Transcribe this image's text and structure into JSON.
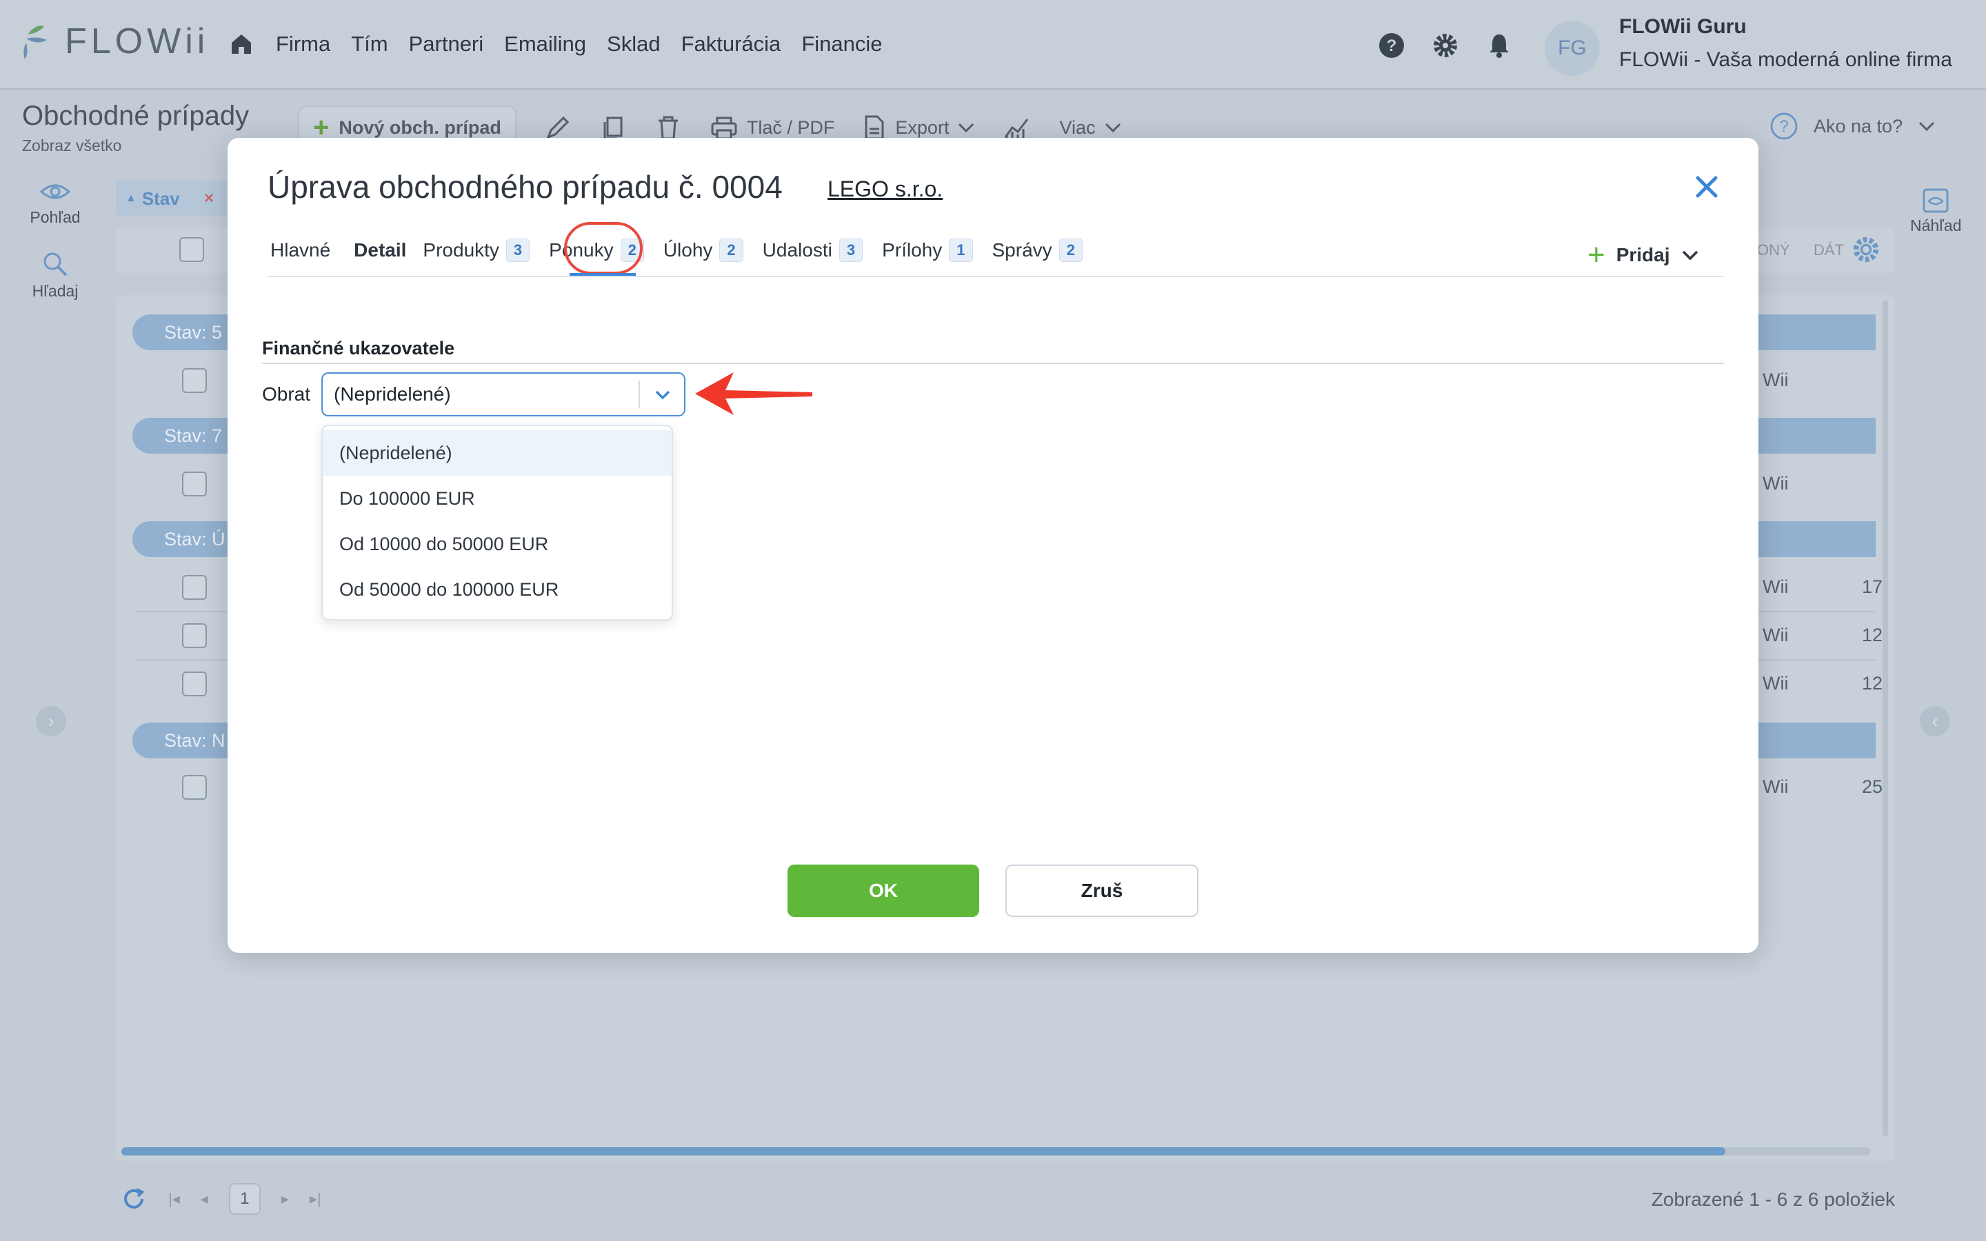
{
  "app": {
    "logo_text": "FLOWii",
    "nav": [
      "Firma",
      "Tím",
      "Partneri",
      "Emailing",
      "Sklad",
      "Fakturácia",
      "Financie"
    ],
    "user_initials": "FG",
    "user_name": "FLOWii Guru",
    "user_company": "FLOWii - Vaša moderná online firma"
  },
  "page": {
    "title": "Obchodné prípady",
    "subtitle": "Zobraz všetko",
    "toolbar": {
      "new_label": "Nový obch. prípad",
      "print_label": "Tlač / PDF",
      "export_label": "Export",
      "more_label": "Viac",
      "help_label": "Ako na to?"
    },
    "rail": {
      "view_label": "Pohľad",
      "search_label": "Hľadaj",
      "preview_label": "Náhľad"
    },
    "filter_chip": "Stav",
    "grid_cols": {
      "col_a": "ONÝ",
      "col_b": "DÁT"
    },
    "groups": [
      "Stav: 5",
      "Stav: 7",
      "Stav: Ú",
      "Stav: N"
    ],
    "row_owner_fragment": "Wii",
    "row_values": [
      "17",
      "12",
      "12",
      "25"
    ],
    "pager": {
      "current_page": "1",
      "info": "Zobrazené 1 - 6 z 6 položiek"
    }
  },
  "modal": {
    "title": "Úprava obchodného prípadu č. 0004",
    "company_link": "LEGO s.r.o.",
    "tabs": [
      {
        "label": "Hlavné",
        "badge": ""
      },
      {
        "label": "Detail",
        "badge": ""
      },
      {
        "label": "Produkty",
        "badge": "3"
      },
      {
        "label": "Ponuky",
        "badge": "2"
      },
      {
        "label": "Úlohy",
        "badge": "2"
      },
      {
        "label": "Udalosti",
        "badge": "3"
      },
      {
        "label": "Prílohy",
        "badge": "1"
      },
      {
        "label": "Správy",
        "badge": "2"
      }
    ],
    "active_tab": "Detail",
    "add_label": "Pridaj",
    "section_title": "Finančné ukazovatele",
    "field_label": "Obrat",
    "select_value": "(Nepridelené)",
    "options": [
      "(Nepridelené)",
      "Do 100000 EUR",
      "Od 10000 do 50000 EUR",
      "Od 50000 do 100000 EUR"
    ],
    "ok_label": "OK",
    "cancel_label": "Zruš"
  },
  "colors": {
    "accent_blue": "#3c86d9",
    "ok_green": "#5fb83a",
    "annotation_red": "#e84a3c",
    "group_blue": "#92b0cf"
  }
}
